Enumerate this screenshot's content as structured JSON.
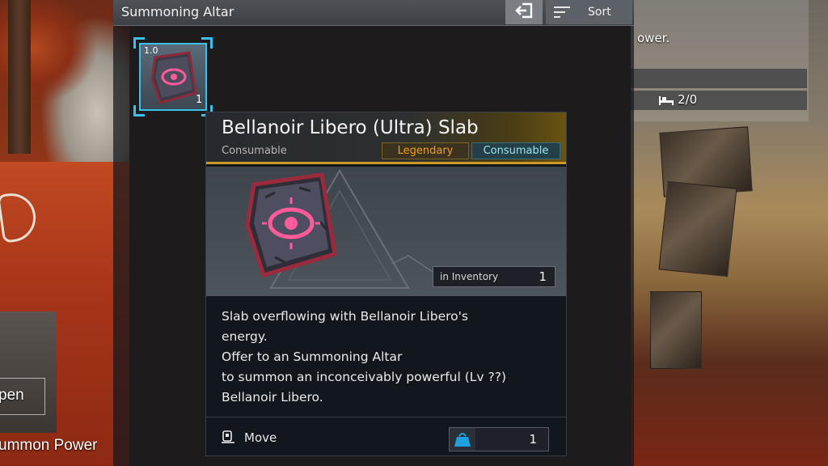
{
  "window": {
    "title": "Summoning Altar",
    "sort_label": "Sort",
    "exit_icon": "exit-icon",
    "sort_icon": "sort-lines-icon"
  },
  "slot": {
    "weight": "1.0",
    "count": "1",
    "icon": "slab-icon"
  },
  "item": {
    "name": "Bellanoir Libero (Ultra) Slab",
    "category": "Consumable",
    "tags": [
      "Legendary",
      "Consumable"
    ],
    "inventory_label": "in Inventory",
    "inventory_count": "1",
    "description": [
      "Slab overflowing with Bellanoir Libero's",
      "energy.",
      "Offer to an Summoning Altar",
      "to summon an inconceivably powerful (Lv ??)",
      "Bellanoir Libero."
    ],
    "move_label": "Move",
    "move_icon": "move-icon",
    "quantity": "1",
    "quantity_icon": "weight-bag-icon"
  },
  "background": {
    "left_text_1": "pen",
    "left_text_2": "ummon Power",
    "right_text_1": "ower.",
    "right_text_2": "2/0",
    "right_icon": "bed-icon"
  },
  "colors": {
    "accent_cyan": "#3bc0ee",
    "legendary": "#f0a020",
    "consumable": "#9ee3f0",
    "header_gold": "#c99a25"
  }
}
